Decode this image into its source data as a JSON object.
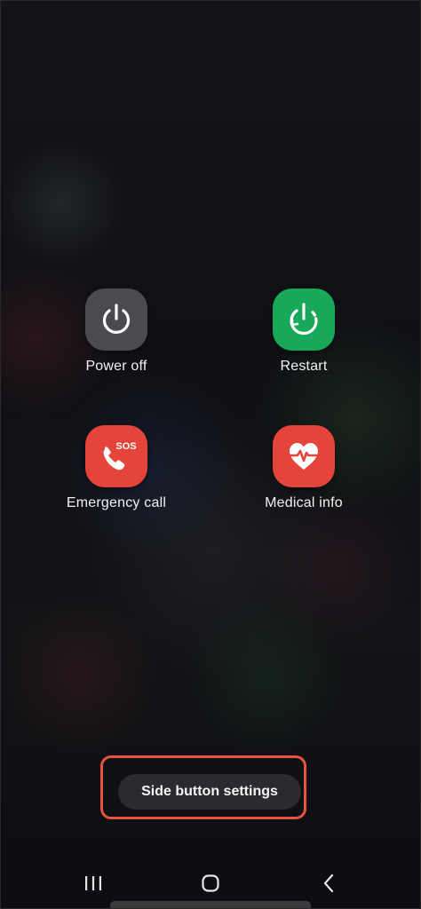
{
  "power_menu": {
    "items": [
      {
        "label": "Power off",
        "icon": "power-icon",
        "color": "#4a4b50"
      },
      {
        "label": "Restart",
        "icon": "restart-icon",
        "color": "#17a85a"
      },
      {
        "label": "Emergency call",
        "icon": "sos-phone-icon",
        "icon_text": "SOS",
        "color": "#e4443a"
      },
      {
        "label": "Medical info",
        "icon": "heart-pulse-icon",
        "color": "#e4443a"
      }
    ],
    "side_button_settings": "Side button settings",
    "highlight_color": "#e8533f"
  },
  "navigation_bar": {
    "recents": "recents-icon",
    "home": "home-icon",
    "back": "back-icon"
  }
}
